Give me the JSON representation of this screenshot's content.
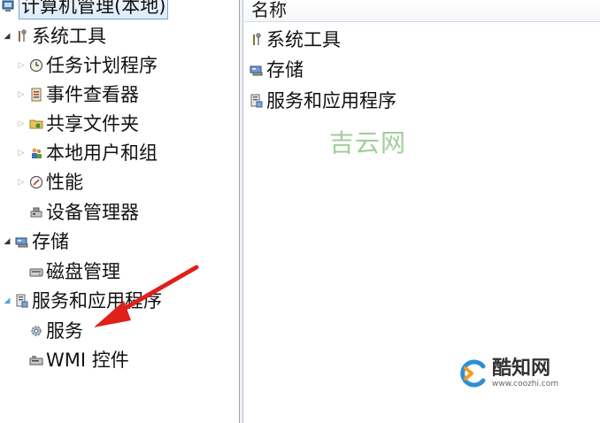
{
  "tree": {
    "root_label": "计算机管理(本地)",
    "items": [
      {
        "label": "系统工具",
        "icon": "tools-icon",
        "level": 0,
        "expander": "open"
      },
      {
        "label": "任务计划程序",
        "icon": "clock-icon",
        "level": 1,
        "expander": "collapsed"
      },
      {
        "label": "事件查看器",
        "icon": "event-viewer-icon",
        "level": 1,
        "expander": "collapsed"
      },
      {
        "label": "共享文件夹",
        "icon": "shared-folder-icon",
        "level": 1,
        "expander": "collapsed"
      },
      {
        "label": "本地用户和组",
        "icon": "users-icon",
        "level": 1,
        "expander": "collapsed"
      },
      {
        "label": "性能",
        "icon": "performance-icon",
        "level": 1,
        "expander": "collapsed"
      },
      {
        "label": "设备管理器",
        "icon": "device-manager-icon",
        "level": 1,
        "expander": "none"
      },
      {
        "label": "存储",
        "icon": "storage-icon",
        "level": 0,
        "expander": "open"
      },
      {
        "label": "磁盘管理",
        "icon": "disk-icon",
        "level": 1,
        "expander": "none"
      },
      {
        "label": "服务和应用程序",
        "icon": "services-apps-icon",
        "level": 0,
        "expander": "open"
      },
      {
        "label": "服务",
        "icon": "gear-icon",
        "level": 1,
        "expander": "none"
      },
      {
        "label": "WMI 控件",
        "icon": "wmi-icon",
        "level": 1,
        "expander": "none"
      }
    ]
  },
  "list": {
    "column_header": "名称",
    "items": [
      {
        "label": "系统工具",
        "icon": "tools-icon"
      },
      {
        "label": "存储",
        "icon": "storage-icon"
      },
      {
        "label": "服务和应用程序",
        "icon": "services-apps-icon"
      }
    ]
  },
  "watermarks": {
    "jiyun": "吉云网",
    "kuzhi_name": "酷知网",
    "kuzhi_url": "www.coozhi.com"
  },
  "colors": {
    "arrow": "#e0201b",
    "selection_border": "#7da2ce",
    "watermark_green": "#9fcf9a"
  }
}
